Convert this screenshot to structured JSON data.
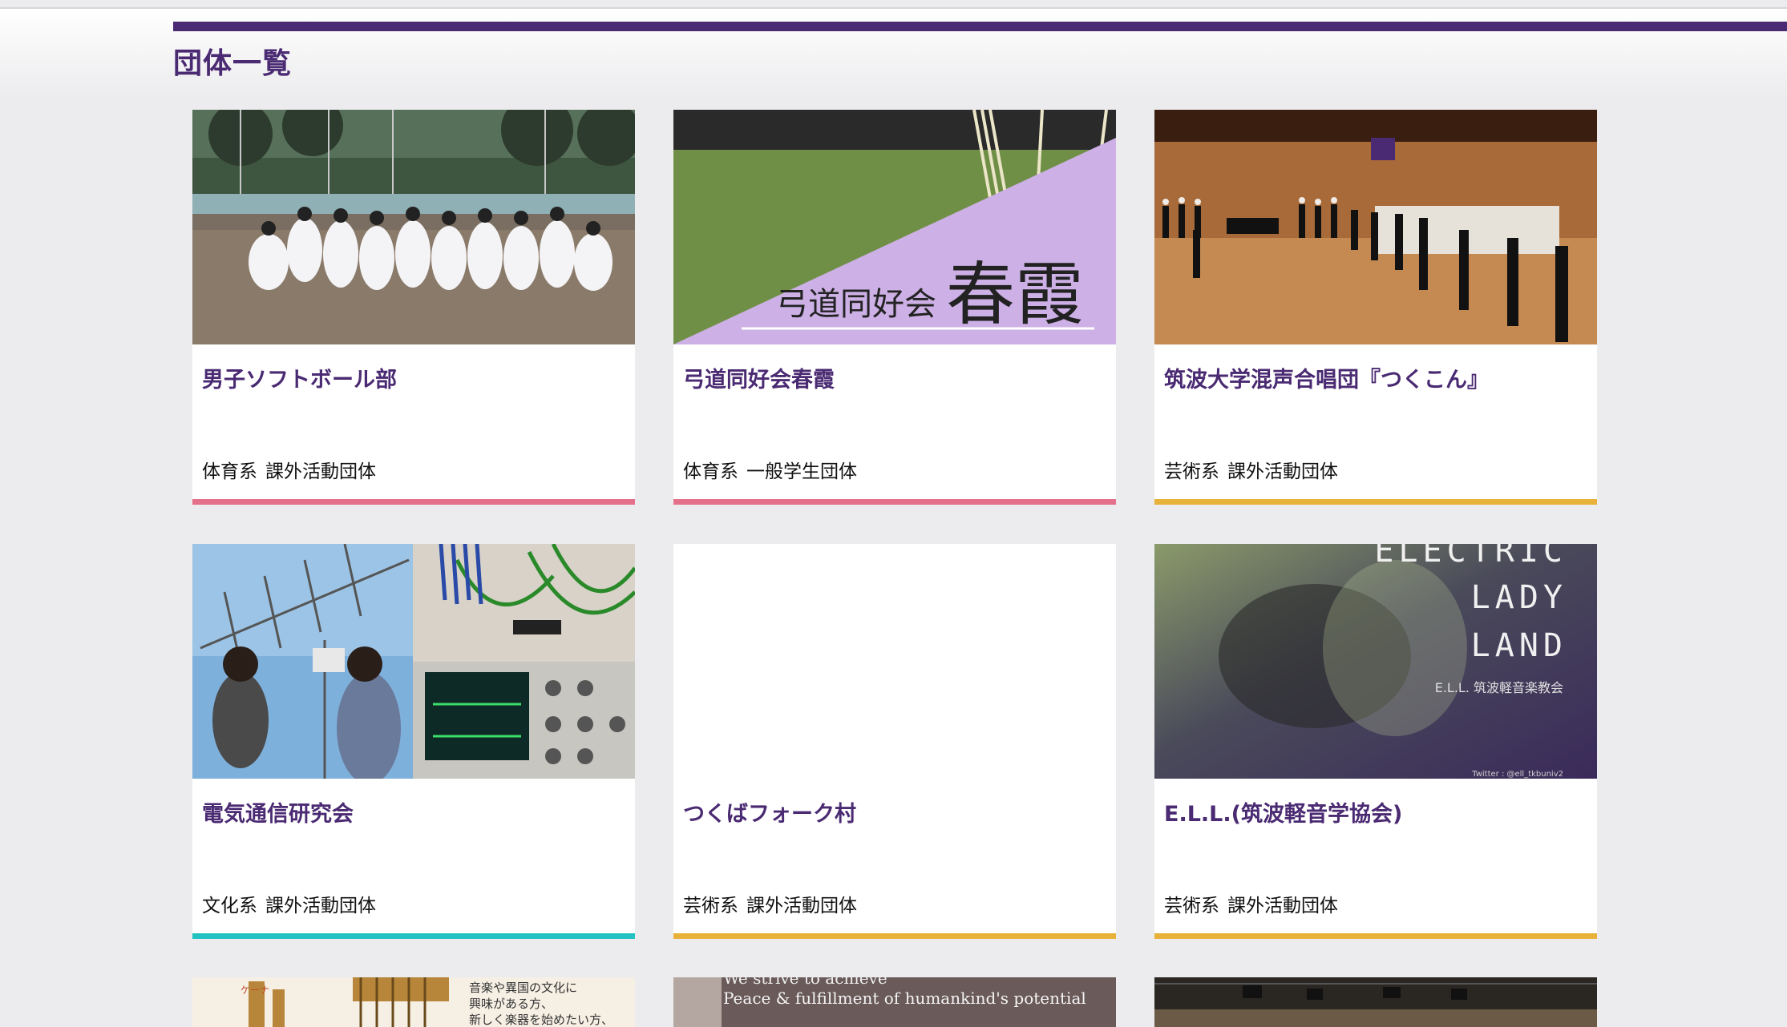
{
  "page": {
    "title": "団体一覧"
  },
  "colors": {
    "accent": "#4a2a72",
    "sports": "#e5708a",
    "arts": "#e8b23a",
    "culture": "#22c2c2"
  },
  "cards": [
    {
      "name": "男子ソフトボール部",
      "field": "体育系",
      "type": "課外活動団体",
      "stripe": "sports",
      "image": "softball-team-photo"
    },
    {
      "name": "弓道同好会春霞",
      "field": "体育系",
      "type": "一般学生団体",
      "stripe": "sports",
      "image": "kyudo-banner",
      "image_text_small": "弓道同好会",
      "image_text_big": "春霞"
    },
    {
      "name": "筑波大学混声合唱団『つくこん』",
      "field": "芸術系",
      "type": "課外活動団体",
      "stripe": "arts",
      "image": "choir-stage-photo"
    },
    {
      "name": "電気通信研究会",
      "field": "文化系",
      "type": "課外活動団体",
      "stripe": "culture",
      "image": "antenna-electronics-collage"
    },
    {
      "name": "つくばフォーク村",
      "field": "芸術系",
      "type": "課外活動団体",
      "stripe": "arts",
      "image": "blank"
    },
    {
      "name": "E.L.L.(筑波軽音学協会)",
      "field": "芸術系",
      "type": "課外活動団体",
      "stripe": "arts",
      "image": "electric-lady-land-poster",
      "image_lines": [
        "ELECTRIC",
        "LADY",
        "LAND"
      ],
      "image_sub": "E.L.L. 筑波軽音楽教会",
      "image_credit": "Twitter : @ell_tkbuniv2"
    }
  ],
  "partial_cards": [
    {
      "image": "instruments-flyer",
      "line1": "音楽や異国の文化に",
      "line2": "興味がある方、",
      "line3": "新しく楽器を始めたい方、",
      "label": "ケーナ"
    },
    {
      "image": "peace-banner",
      "line1": "We strive to achieve",
      "line2": "Peace & fulfillment of humankind's potential"
    },
    {
      "image": "stage-lighting-photo"
    }
  ]
}
